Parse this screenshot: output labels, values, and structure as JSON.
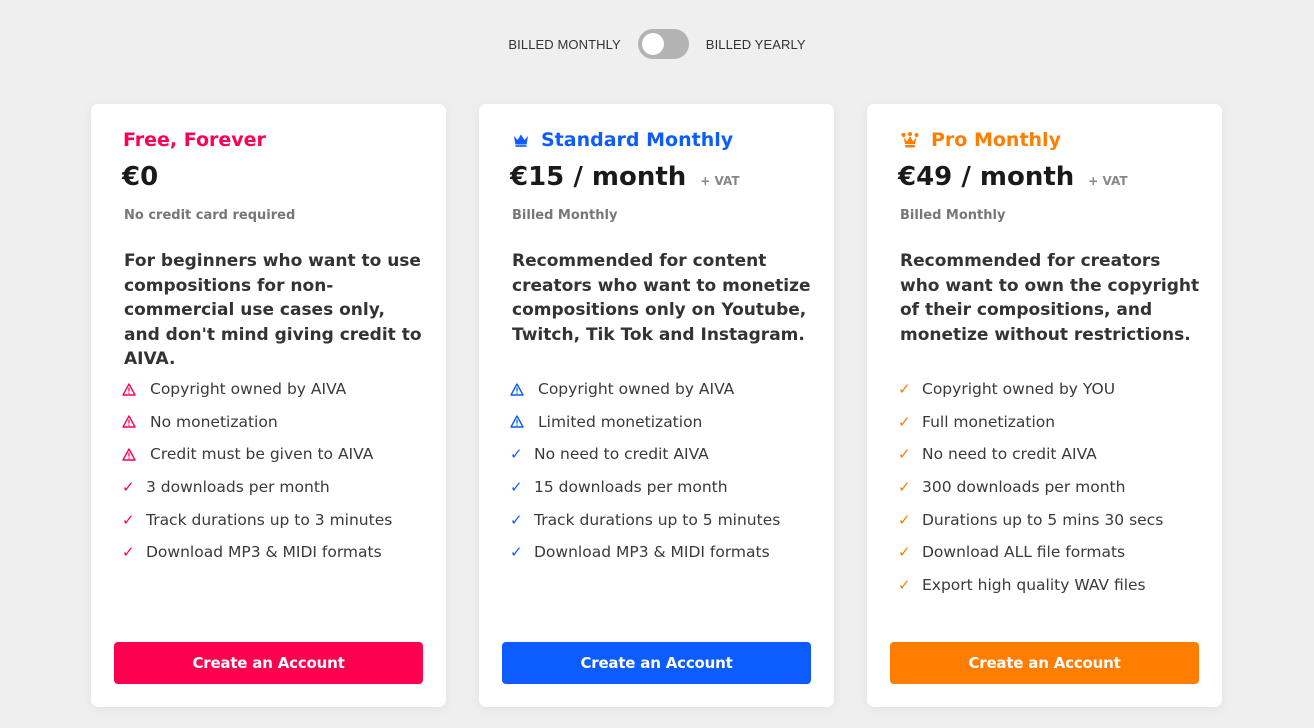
{
  "billing_toggle": {
    "left_label": "BILLED MONTHLY",
    "right_label": "BILLED YEARLY",
    "state": "monthly"
  },
  "colors": {
    "free": "#ff0050",
    "standard": "#0d5cff",
    "pro": "#ff7d00",
    "background": "#efefef"
  },
  "plans": [
    {
      "title": "Free, Forever",
      "title_icon": "",
      "price": "€0",
      "vat": "",
      "subtitle": "No credit card required",
      "description": "For beginners who want to use compositions for non-commercial use cases only, and don't mind giving credit to AIVA.",
      "features": [
        {
          "icon": "warning-icon",
          "text": "Copyright owned by AIVA"
        },
        {
          "icon": "warning-icon",
          "text": "No monetization"
        },
        {
          "icon": "warning-icon",
          "text": "Credit must be given to AIVA"
        },
        {
          "icon": "check-icon",
          "text": "3 downloads per month"
        },
        {
          "icon": "check-icon",
          "text": "Track durations up to 3 minutes"
        },
        {
          "icon": "check-icon",
          "text": "Download MP3 & MIDI formats"
        }
      ],
      "cta": "Create an Account"
    },
    {
      "title": "Standard Monthly",
      "title_icon": "crown-icon",
      "price": "€15 / month",
      "vat": "+ VAT",
      "subtitle": "Billed Monthly",
      "description": "Recommended for content creators who want to monetize compositions only on Youtube, Twitch, Tik Tok and Instagram.",
      "features": [
        {
          "icon": "warning-icon",
          "text": "Copyright owned by AIVA"
        },
        {
          "icon": "warning-icon",
          "text": "Limited monetization"
        },
        {
          "icon": "check-icon",
          "text": "No need to credit AIVA"
        },
        {
          "icon": "check-icon",
          "text": "15 downloads per month"
        },
        {
          "icon": "check-icon",
          "text": "Track durations up to 5 minutes"
        },
        {
          "icon": "check-icon",
          "text": "Download MP3 & MIDI formats"
        }
      ],
      "cta": "Create an Account"
    },
    {
      "title": "Pro Monthly",
      "title_icon": "jester-crown-icon",
      "price": "€49 / month",
      "vat": "+ VAT",
      "subtitle": "Billed Monthly",
      "description": "Recommended for creators who want to own the copyright of their compositions, and monetize without restrictions.",
      "features": [
        {
          "icon": "check-icon",
          "text": "Copyright owned by YOU"
        },
        {
          "icon": "check-icon",
          "text": "Full monetization"
        },
        {
          "icon": "check-icon",
          "text": "No need to credit AIVA"
        },
        {
          "icon": "check-icon",
          "text": "300 downloads per month"
        },
        {
          "icon": "check-icon",
          "text": "Durations up to 5 mins 30 secs"
        },
        {
          "icon": "check-icon",
          "text": "Download ALL file formats"
        },
        {
          "icon": "check-icon",
          "text": "Export high quality WAV files"
        }
      ],
      "cta": "Create an Account"
    }
  ]
}
